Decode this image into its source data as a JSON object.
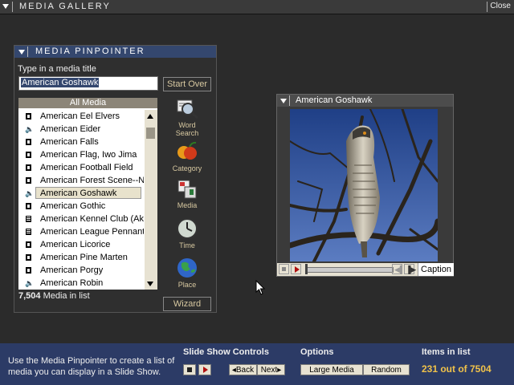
{
  "window": {
    "title": "MEDIA GALLERY",
    "close_label": "Close"
  },
  "pinpointer": {
    "title": "MEDIA PINPOINTER",
    "input_label": "Type in a media title",
    "input_value": "American Goshawk",
    "start_over": "Start Over",
    "list_header": "All Media",
    "items": [
      {
        "label": "American Eel Elvers",
        "icon": "film"
      },
      {
        "label": "American Eider",
        "icon": "speaker"
      },
      {
        "label": "American Falls",
        "icon": "film"
      },
      {
        "label": "American Flag, Iwo Jima",
        "icon": "film"
      },
      {
        "label": "American Football Field",
        "icon": "film"
      },
      {
        "label": "American Forest Scene--N",
        "icon": "film"
      },
      {
        "label": "American Goshawk",
        "icon": "speaker",
        "selected": true
      },
      {
        "label": "American Gothic",
        "icon": "film"
      },
      {
        "label": "American Kennel Club (Ak",
        "icon": "grid"
      },
      {
        "label": "American League Pennant",
        "icon": "grid"
      },
      {
        "label": "American Licorice",
        "icon": "film"
      },
      {
        "label": "American Pine Marten",
        "icon": "film"
      },
      {
        "label": "American Porgy",
        "icon": "film"
      },
      {
        "label": "American Robin",
        "icon": "speaker"
      }
    ],
    "count_number": "7,504",
    "count_text": " Media in list",
    "wizard": "Wizard",
    "tools": [
      {
        "label": "Word Search",
        "icon": "magnifier-icon"
      },
      {
        "label": "Category",
        "icon": "fruit-icon"
      },
      {
        "label": "Media",
        "icon": "blocks-icon"
      },
      {
        "label": "Time",
        "icon": "clock-icon"
      },
      {
        "label": "Place",
        "icon": "globe-icon"
      }
    ]
  },
  "viewer": {
    "title": "American Goshawk",
    "caption_label": "Caption"
  },
  "bottom": {
    "info": "Use the Media Pinpointer to create a list of media you can display in a Slide Show.",
    "slideshow_heading": "Slide Show Controls",
    "back_label": "Back",
    "next_label": "Next",
    "options_heading": "Options",
    "large_media_label": "Large Media",
    "random_label": "Random",
    "items_heading": "Items in list",
    "items_count": "231 out of 7504"
  },
  "colors": {
    "header_blue": "#34476e",
    "bottom_blue": "#2c3b66",
    "gold": "#f0c24a"
  }
}
